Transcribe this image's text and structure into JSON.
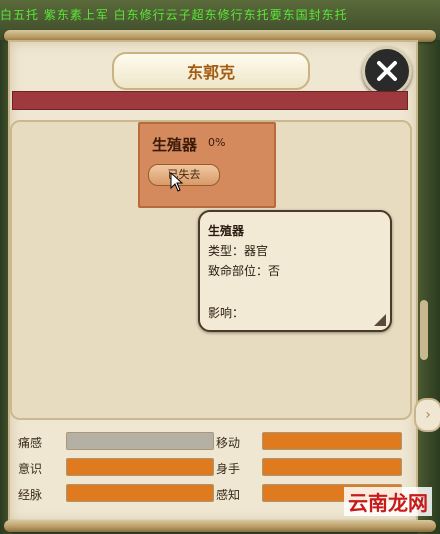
{
  "background": {
    "ticker_text": "白五托 紫东素上军 白东修行云子超东修行东托要东国封东托"
  },
  "panel": {
    "title": "东郭克",
    "close_icon": "close-icon",
    "accent_red": "#9e3a3e"
  },
  "organ_card": {
    "name": "生殖器",
    "percent": "0%",
    "button_label": "已失去",
    "color": "#d48a5c"
  },
  "tooltip": {
    "title": "生殖器",
    "type_line": "类型：器官",
    "fatal_line": "致命部位：否",
    "effect_line": "影响："
  },
  "stats": [
    {
      "label": "痛感",
      "fill": 1.0,
      "color": "grey"
    },
    {
      "label": "移动",
      "fill": 1.0,
      "color": "orange"
    },
    {
      "label": "意识",
      "fill": 1.0,
      "color": "orange"
    },
    {
      "label": "身手",
      "fill": 1.0,
      "color": "orange"
    },
    {
      "label": "经脉",
      "fill": 1.0,
      "color": "orange"
    },
    {
      "label": "感知",
      "fill": 1.0,
      "color": "orange"
    }
  ],
  "watermark": "云南龙网"
}
